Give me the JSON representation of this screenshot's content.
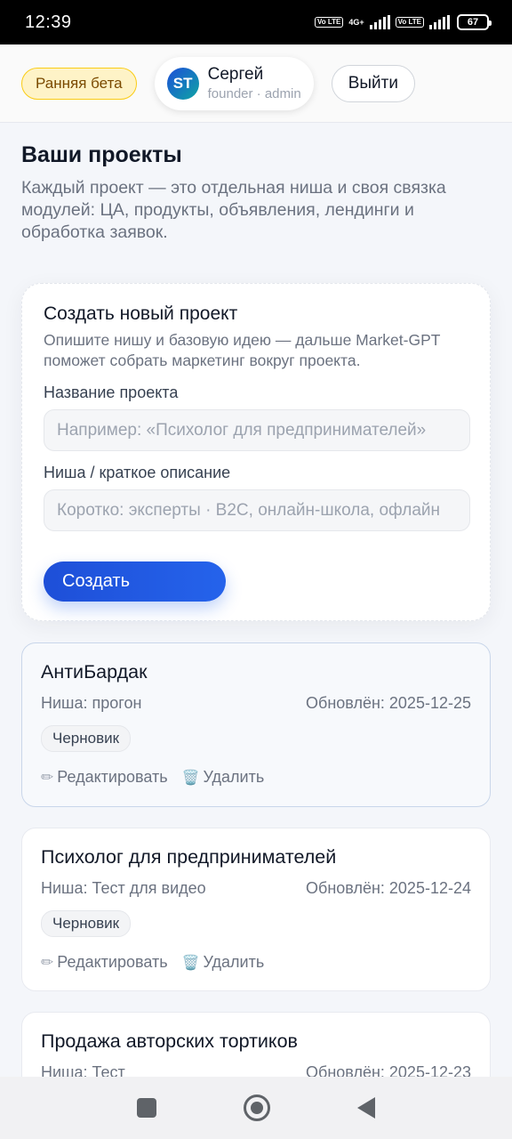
{
  "status_bar": {
    "time": "12:39",
    "volte1": "Vo LTE",
    "network": "4G+",
    "volte2": "Vo LTE",
    "battery": "67"
  },
  "header": {
    "beta_label": "Ранняя бета",
    "user": {
      "initials": "ST",
      "name": "Сергей",
      "role": "founder · admin"
    },
    "logout_label": "Выйти"
  },
  "intro": {
    "title": "Ваши проекты",
    "description": "Каждый проект — это отдельная ниша и своя связка модулей: ЦА, продукты, объявления, лендинги и обработка заявок."
  },
  "create_form": {
    "title": "Создать новый проект",
    "description": "Опишите нишу и базовую идею — дальше Market-GPT поможет собрать маркетинг вокруг проекта.",
    "name_label": "Название проекта",
    "name_placeholder": "Например: «Психолог для предпринимателей»",
    "niche_label": "Ниша / краткое описание",
    "niche_placeholder": "Коротко: эксперты · B2C, онлайн-школа, офлайн",
    "submit_label": "Создать"
  },
  "projects": [
    {
      "title": "АнтиБардак",
      "niche": "Ниша: прогон",
      "updated": "Обновлён: 2025-12-25",
      "status": "Черновик",
      "edit_label": "Редактировать",
      "delete_label": "Удалить"
    },
    {
      "title": "Психолог для предпринимателей",
      "niche": "Ниша: Тест для видео",
      "updated": "Обновлён: 2025-12-24",
      "status": "Черновик",
      "edit_label": "Редактировать",
      "delete_label": "Удалить"
    },
    {
      "title": "Продажа авторских тортиков",
      "niche": "Ниша: Тест",
      "updated": "Обновлён: 2025-12-23"
    }
  ],
  "icons": {
    "edit": "pencil-icon",
    "delete": "trash-icon",
    "nav_recents": "square-icon",
    "nav_home": "circle-icon",
    "nav_back": "triangle-back-icon"
  },
  "colors": {
    "primary": "#2563eb",
    "beta_bg": "#fef3c7",
    "beta_border": "#facc15",
    "page_bg": "#f4f6fa"
  }
}
